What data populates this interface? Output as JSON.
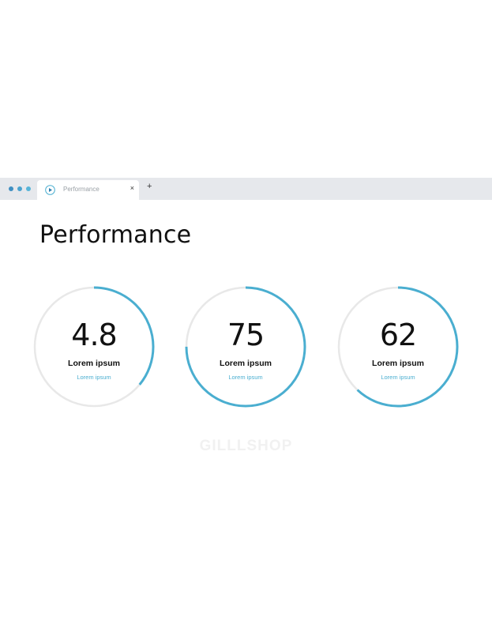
{
  "browser": {
    "dot_colors": [
      "#3f8fc2",
      "#4aa3cf",
      "#57b4d8"
    ],
    "tab": {
      "title": "Performance",
      "icon": "play-icon",
      "close": "×"
    },
    "new_tab": "+"
  },
  "page": {
    "title": "Performance"
  },
  "metrics": [
    {
      "value": "4.8",
      "label": "Lorem ipsum",
      "sublabel": "Lorem ipsum",
      "progress": 0.36
    },
    {
      "value": "75",
      "label": "Lorem ipsum",
      "sublabel": "Lorem ipsum",
      "progress": 0.75
    },
    {
      "value": "62",
      "label": "Lorem ipsum",
      "sublabel": "Lorem ipsum",
      "progress": 0.62
    }
  ],
  "colors": {
    "accent": "#4aaed0",
    "track": "#e8e8e8"
  },
  "watermark": "GILLLSHOP"
}
